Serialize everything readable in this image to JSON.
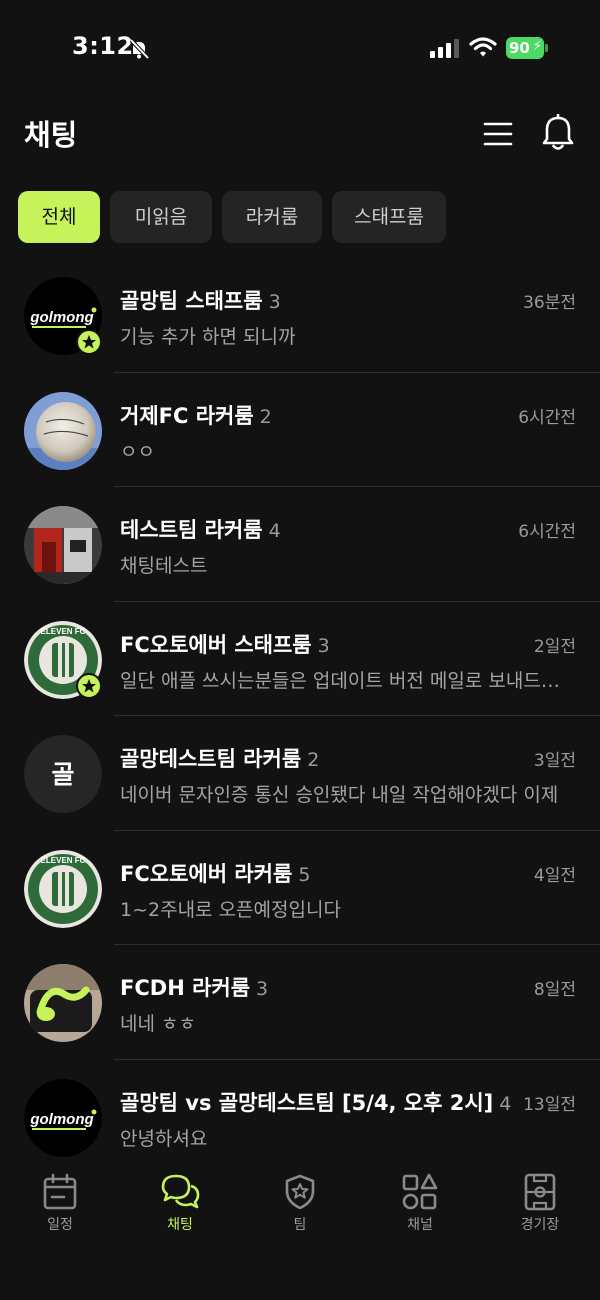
{
  "status_bar": {
    "time": "3:12",
    "battery": "90"
  },
  "header": {
    "title": "채팅"
  },
  "filters": [
    {
      "label": "전체",
      "active": true
    },
    {
      "label": "미읽음",
      "active": false
    },
    {
      "label": "라커룸",
      "active": false
    },
    {
      "label": "스태프룸",
      "active": false
    }
  ],
  "chats": [
    {
      "name": "골망팀 스태프룸",
      "count": "3",
      "time": "36분전",
      "preview": "기능 추가 하면 되니까",
      "avatar_text": "golmong",
      "staff_badge": true
    },
    {
      "name": "거제FC 라커룸",
      "count": "2",
      "time": "6시간전",
      "preview": "ㅇㅇ",
      "avatar_text": "",
      "staff_badge": false
    },
    {
      "name": "테스트팀 라커룸",
      "count": "4",
      "time": "6시간전",
      "preview": "채팅테스트",
      "avatar_text": "",
      "staff_badge": false
    },
    {
      "name": "FC오토에버 스태프룸",
      "count": "3",
      "time": "2일전",
      "preview": "일단 애플 쓰시는분들은 업데이트 버전 메일로 보내드리겠습니다",
      "avatar_text": "ELEVEN FC",
      "staff_badge": true
    },
    {
      "name": "골망테스트팀 라커룸",
      "count": "2",
      "time": "3일전",
      "preview": "네이버 문자인증 통신 승인됐다 내일 작업해야겠다 이제",
      "avatar_text": "골",
      "staff_badge": false
    },
    {
      "name": "FC오토에버 라커룸",
      "count": "5",
      "time": "4일전",
      "preview": "1~2주내로 오픈예정입니다",
      "avatar_text": "ELEVEN FC",
      "staff_badge": false
    },
    {
      "name": "FCDH 라커룸",
      "count": "3",
      "time": "8일전",
      "preview": "네네 ㅎㅎ",
      "avatar_text": "",
      "staff_badge": false
    },
    {
      "name": "골망팀 vs 골망테스트팀 [5/4, 오후 2시]",
      "count": "4",
      "time": "13일전",
      "preview": "안녕하셔요",
      "avatar_text": "golmong",
      "staff_badge": false
    }
  ],
  "nav": [
    {
      "label": "일정",
      "icon": "calendar-icon",
      "active": false
    },
    {
      "label": "채팅",
      "icon": "chat-bubbles-icon",
      "active": true
    },
    {
      "label": "팀",
      "icon": "shield-star-icon",
      "active": false
    },
    {
      "label": "채널",
      "icon": "shapes-icon",
      "active": false
    },
    {
      "label": "경기장",
      "icon": "field-icon",
      "active": false
    }
  ],
  "colors": {
    "accent": "#c6f25a",
    "background": "#121212",
    "muted": "#9a9a9a"
  }
}
